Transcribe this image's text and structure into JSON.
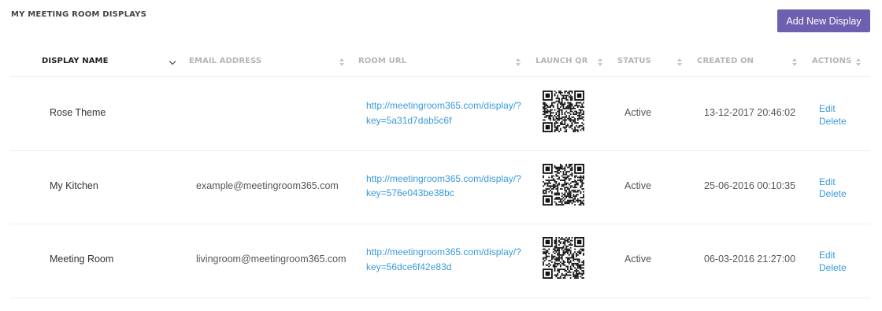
{
  "page": {
    "title": "MY MEETING ROOM DISPLAYS",
    "add_button": "Add New Display"
  },
  "table": {
    "columns": [
      {
        "label": "DISPLAY NAME",
        "sorted": "desc"
      },
      {
        "label": "EMAIL ADDRESS",
        "sorted": "none"
      },
      {
        "label": "ROOM URL",
        "sorted": "none"
      },
      {
        "label": "LAUNCH QR",
        "sorted": "none"
      },
      {
        "label": "STATUS",
        "sorted": "none"
      },
      {
        "label": "CREATED ON",
        "sorted": "none"
      },
      {
        "label": "ACTIONS",
        "sorted": "none"
      }
    ],
    "rows": [
      {
        "name": "Rose Theme",
        "email": "",
        "url_line1": "http://meetingroom365.com/display/?",
        "url_line2": "key=5a31d7dab5c6f",
        "qr_icon": "qr-code-icon",
        "status": "Active",
        "created": "13-12-2017 20:46:02",
        "edit": "Edit",
        "delete": "Delete"
      },
      {
        "name": "My Kitchen",
        "email": "example@meetingroom365.com",
        "url_line1": "http://meetingroom365.com/display/?",
        "url_line2": "key=576e043be38bc",
        "qr_icon": "qr-code-icon",
        "status": "Active",
        "created": "25-06-2016 00:10:35",
        "edit": "Edit",
        "delete": "Delete"
      },
      {
        "name": "Meeting Room",
        "email": "livingroom@meetingroom365.com",
        "url_line1": "http://meetingroom365.com/display/?",
        "url_line2": "key=56dce6f42e83d",
        "qr_icon": "qr-code-icon",
        "status": "Active",
        "created": "06-03-2016 21:27:00",
        "edit": "Edit",
        "delete": "Delete"
      }
    ]
  },
  "colors": {
    "accent_button": "#6e5fb0",
    "link": "#3a9ad9",
    "header_muted": "#b5b5b5"
  }
}
